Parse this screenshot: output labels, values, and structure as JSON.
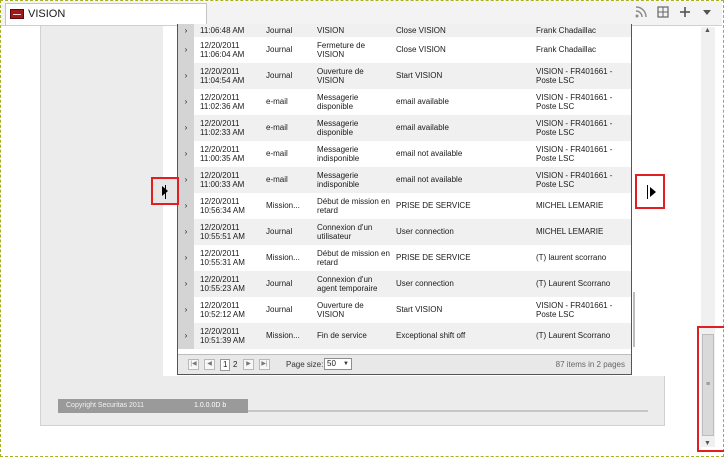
{
  "browser": {
    "tab_title": "VISION",
    "toolbar_icons": [
      "rss-icon",
      "home-icon",
      "add-icon",
      "menu-down-icon"
    ]
  },
  "table": {
    "rows": [
      {
        "date": "",
        "time": "11:06:48 AM",
        "type": "Journal",
        "title": "VISION",
        "message": "Close VISION",
        "user": "Frank Chadaillac",
        "partial": true
      },
      {
        "date": "12/20/2011",
        "time": "11:06:04 AM",
        "type": "Journal",
        "title": "Fermeture de VISION",
        "message": "Close VISION",
        "user": "Frank Chadaillac"
      },
      {
        "date": "12/20/2011",
        "time": "11:04:54 AM",
        "type": "Journal",
        "title": "Ouverture de VISION",
        "message": "Start VISION",
        "user": "VISION - FR401661 - Poste LSC"
      },
      {
        "date": "12/20/2011",
        "time": "11:02:36 AM",
        "type": "e-mail",
        "title": "Messagerie disponible",
        "message": "email available",
        "user": "VISION - FR401661 - Poste LSC"
      },
      {
        "date": "12/20/2011",
        "time": "11:02:33 AM",
        "type": "e-mail",
        "title": "Messagerie disponible",
        "message": "email available",
        "user": "VISION - FR401661 - Poste LSC"
      },
      {
        "date": "12/20/2011",
        "time": "11:00:35 AM",
        "type": "e-mail",
        "title": "Messagerie indisponible",
        "message": "email not available",
        "user": "VISION - FR401661 - Poste LSC"
      },
      {
        "date": "12/20/2011",
        "time": "11:00:33 AM",
        "type": "e-mail",
        "title": "Messagerie indisponible",
        "message": "email not available",
        "user": "VISION - FR401661 - Poste LSC"
      },
      {
        "date": "12/20/2011",
        "time": "10:56:34 AM",
        "type": "Mission...",
        "title": "Début de mission en retard",
        "message": "PRISE DE SERVICE",
        "user": "MICHEL LEMARIE"
      },
      {
        "date": "12/20/2011",
        "time": "10:55:51 AM",
        "type": "Journal",
        "title": "Connexion d'un utilisateur",
        "message": "User connection",
        "user": "MICHEL LEMARIE"
      },
      {
        "date": "12/20/2011",
        "time": "10:55:31 AM",
        "type": "Mission...",
        "title": "Début de mission en retard",
        "message": "PRISE DE SERVICE",
        "user": "(T) laurent scorrano"
      },
      {
        "date": "12/20/2011",
        "time": "10:55:23 AM",
        "type": "Journal",
        "title": "Connexion d'un agent temporaire",
        "message": "User connection",
        "user": "(T) Laurent Scorrano"
      },
      {
        "date": "12/20/2011",
        "time": "10:52:12 AM",
        "type": "Journal",
        "title": "Ouverture de VISION",
        "message": "Start VISION",
        "user": "VISION - FR401661 - Poste LSC"
      },
      {
        "date": "12/20/2011",
        "time": "10:51:39 AM",
        "type": "Mission...",
        "title": "Fin de service",
        "message": "Exceptional shift off",
        "user": "(T) Laurent Scorrano"
      }
    ],
    "expand_glyph": "›"
  },
  "pager": {
    "pages": [
      "1",
      "2"
    ],
    "current_page": "1",
    "page_size_label": "Page size:",
    "page_size": "50",
    "summary": "87 items in 2 pages"
  },
  "footer": {
    "copyright": "Copyright Securitas 2011",
    "version": "1.0.0.0D   b"
  },
  "colors": {
    "highlight": "#e02020",
    "footer_bar": "#9a9a9a",
    "row_alt": "#f0f0f0"
  }
}
